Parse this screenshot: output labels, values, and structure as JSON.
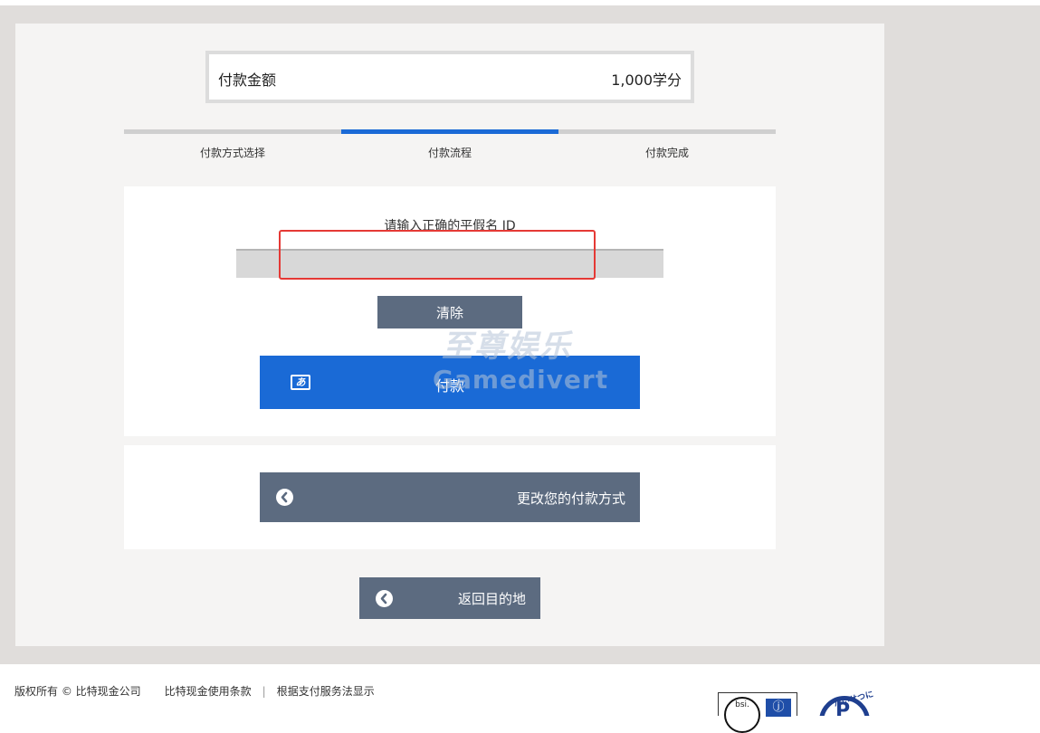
{
  "amount": {
    "label": "付款金额",
    "value": "1,000学分"
  },
  "steps": [
    {
      "label": "付款方式选择",
      "active": false
    },
    {
      "label": "付款流程",
      "active": true
    },
    {
      "label": "付款完成",
      "active": false
    }
  ],
  "form": {
    "prompt": "请输入正确的平假名 ID",
    "input_value": "",
    "clear_label": "清除",
    "pay_label": "付款",
    "pay_logo": "あ"
  },
  "watermark": {
    "cn": "至尊娱乐",
    "en": "Gamedivert"
  },
  "change_method": {
    "label": "更改您的付款方式"
  },
  "back": {
    "label": "返回目的地"
  },
  "footer": {
    "copyright": "版权所有 © 比特现金公司",
    "terms": "比特现金使用条款",
    "separator": "|",
    "notice": "根据支付服务法显示"
  },
  "badges": {
    "bsi_text": "bsi.",
    "jp_mark": "ⓙ",
    "privacy_text": "たいせつにします プライバシー",
    "privacy_letter": "P"
  },
  "colors": {
    "accent": "#1a6ad6",
    "button_gray": "#5c6b80",
    "highlight": "#e53935"
  },
  "icons": {
    "back": "chevron-left-circle-icon",
    "pay_logo": "payment-logo-icon"
  }
}
